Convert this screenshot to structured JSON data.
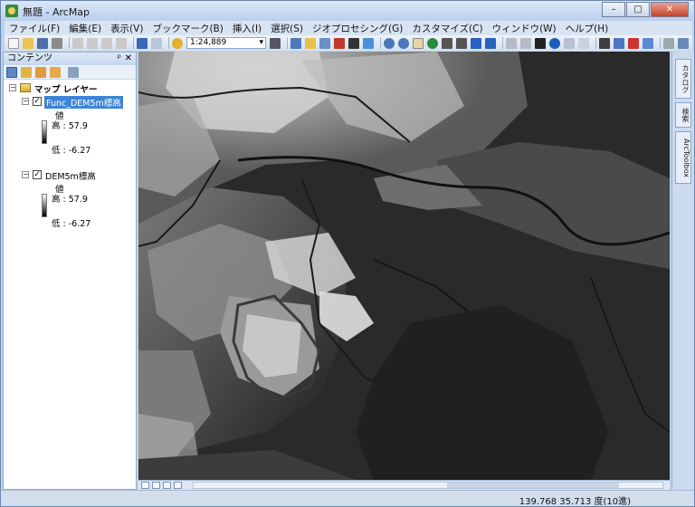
{
  "window": {
    "title": "無題 - ArcMap",
    "minimize_label": "–",
    "maximize_label": "□",
    "close_label": "✕"
  },
  "menu": [
    "ファイル(F)",
    "編集(E)",
    "表示(V)",
    "ブックマーク(B)",
    "挿入(I)",
    "選択(S)",
    "ジオプロセシング(G)",
    "カスタマイズ(C)",
    "ウィンドウ(W)",
    "ヘルプ(H)"
  ],
  "toolbar": {
    "scale_value": "1:24,889"
  },
  "toc": {
    "title": "コンテンツ",
    "pin_label": "ᵖ",
    "close_label": "✕",
    "root_label": "マップ レイヤー",
    "layers": [
      {
        "name": "Func_DEM5m標高",
        "selected": true,
        "legend_heading": "値",
        "high_label": "高 : 57.9",
        "low_label": "低 : -6.27"
      },
      {
        "name": "DEM5m標高",
        "selected": false,
        "legend_heading": "値",
        "high_label": "高 : 57.9",
        "low_label": "低 : -6.27"
      }
    ]
  },
  "rightbar": {
    "tabs": [
      "カタログ",
      "検索",
      "ArcToolbox"
    ]
  },
  "status": {
    "coordinates": "139.768  35.713 度(10進)"
  }
}
